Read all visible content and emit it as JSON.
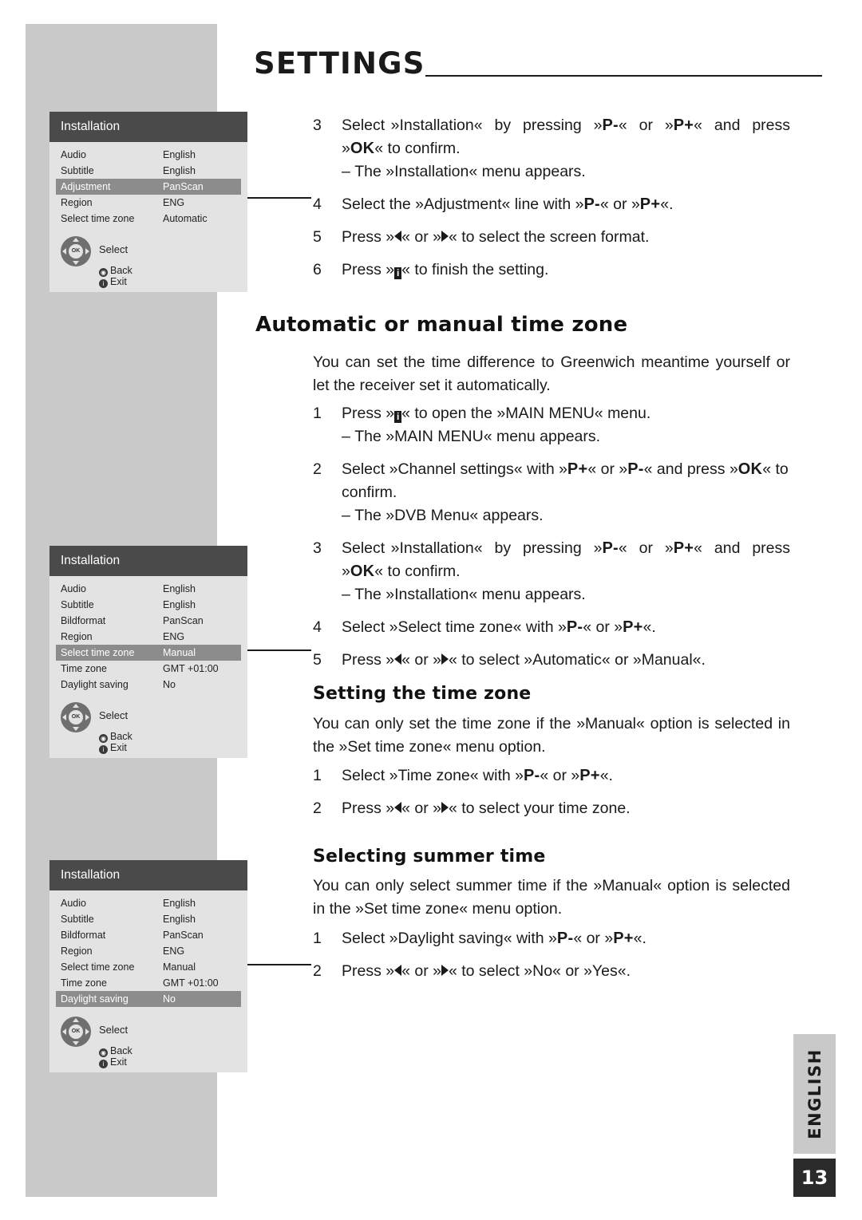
{
  "header": {
    "title": "SETTINGS"
  },
  "page": {
    "number": "13",
    "language_tab": "ENGLISH"
  },
  "sections": {
    "screen_format_steps": [
      {
        "num": "3",
        "text_parts": [
          "Select »Installation« by pressing »",
          "P-",
          "« or »",
          "P+",
          "« and press »",
          "OK",
          "« to confirm."
        ],
        "sub": "– The »Installation« menu appears."
      },
      {
        "num": "4",
        "text_parts": [
          "Select the »Adjustment« line with »",
          "P-",
          "« or »",
          "P+",
          "«."
        ],
        "sub": ""
      },
      {
        "num": "5",
        "text_parts": [
          "Press »",
          "◀",
          "« or »",
          "▶",
          "« to select the screen format."
        ],
        "sub": ""
      },
      {
        "num": "6",
        "text_parts": [
          "Press »",
          "i",
          "« to finish the setting."
        ],
        "sub": ""
      }
    ],
    "time_zone": {
      "heading": "Automatic or manual time zone",
      "intro": "You can set the time difference to Greenwich meantime yourself or let the receiver set it automatically.",
      "steps": [
        {
          "num": "1",
          "main": "Press »i« to open the »MAIN MENU« menu.",
          "sub": "– The »MAIN MENU« menu appears."
        },
        {
          "num": "2",
          "main": "Select »Channel settings« with »P+« or »P-« and press »OK« to confirm.",
          "sub": "– The »DVB Menu« appears."
        },
        {
          "num": "3",
          "main": "Select »Installation« by pressing »P-« or »P+« and press »OK« to confirm.",
          "sub": "– The »Installation« menu appears."
        },
        {
          "num": "4",
          "main": "Select »Select time zone« with »P-« or »P+«.",
          "sub": ""
        },
        {
          "num": "5",
          "main": "Press »◀« or »▶« to select »Automatic« or »Manual«.",
          "sub": ""
        }
      ]
    },
    "setting_time_zone": {
      "heading": "Setting the time zone",
      "intro": "You can only set the time zone if the »Manual« option is selected in the »Set time zone« menu option.",
      "steps": [
        {
          "num": "1",
          "main": "Select »Time zone« with »P-« or »P+«."
        },
        {
          "num": "2",
          "main": "Press »◀« or »▶« to select your time zone."
        }
      ]
    },
    "summer_time": {
      "heading": "Selecting summer time",
      "intro": "You can only select summer time if the »Manual« option is selected in the »Set time zone« menu option.",
      "steps": [
        {
          "num": "1",
          "main": "Select »Daylight saving« with »P-« or »P+«."
        },
        {
          "num": "2",
          "main": "Press »◀« or »▶« to select »No« or »Yes«."
        }
      ]
    }
  },
  "osd_boxes": [
    {
      "title": "Installation",
      "rows": [
        {
          "label": "Audio",
          "value": "English",
          "selected": false
        },
        {
          "label": "Subtitle",
          "value": "English",
          "selected": false
        },
        {
          "label": "Adjustment",
          "value": "PanScan",
          "selected": true
        },
        {
          "label": "Region",
          "value": "ENG",
          "selected": false
        },
        {
          "label": "Select time zone",
          "value": "Automatic",
          "selected": false
        }
      ],
      "select_label": "Select",
      "back_label": "Back",
      "exit_label": "Exit",
      "ok_label": "OK"
    },
    {
      "title": "Installation",
      "rows": [
        {
          "label": "Audio",
          "value": "English",
          "selected": false
        },
        {
          "label": "Subtitle",
          "value": "English",
          "selected": false
        },
        {
          "label": "Bildformat",
          "value": "PanScan",
          "selected": false
        },
        {
          "label": "Region",
          "value": "ENG",
          "selected": false
        },
        {
          "label": "Select time zone",
          "value": "Manual",
          "selected": true
        },
        {
          "label": "Time zone",
          "value": "GMT +01:00",
          "selected": false
        },
        {
          "label": "Daylight saving",
          "value": "No",
          "selected": false
        }
      ],
      "select_label": "Select",
      "back_label": "Back",
      "exit_label": "Exit",
      "ok_label": "OK"
    },
    {
      "title": "Installation",
      "rows": [
        {
          "label": "Audio",
          "value": "English",
          "selected": false
        },
        {
          "label": "Subtitle",
          "value": "English",
          "selected": false
        },
        {
          "label": "Bildformat",
          "value": "PanScan",
          "selected": false
        },
        {
          "label": "Region",
          "value": "ENG",
          "selected": false
        },
        {
          "label": "Select time zone",
          "value": "Manual",
          "selected": false
        },
        {
          "label": "Time zone",
          "value": "GMT +01:00",
          "selected": false
        },
        {
          "label": "Daylight saving",
          "value": "No",
          "selected": true
        }
      ],
      "select_label": "Select",
      "back_label": "Back",
      "exit_label": "Exit",
      "ok_label": "OK"
    }
  ],
  "colors": {
    "band": "#c9c9c9",
    "osd_title_bg": "#4a4a4a",
    "osd_body_bg": "#e3e3e3",
    "osd_selected": "#8c8c8c",
    "page_badge": "#2b2b2b"
  }
}
